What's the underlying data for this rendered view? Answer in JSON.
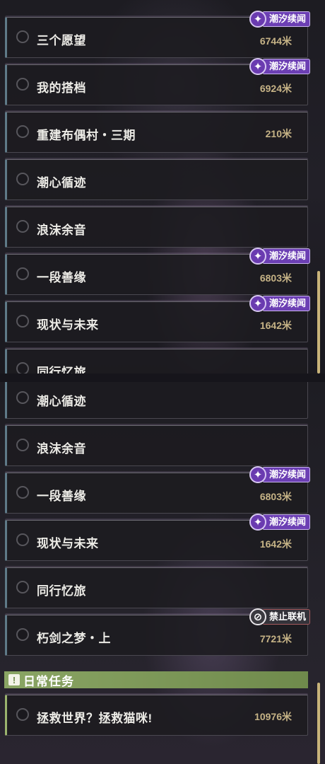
{
  "tags": {
    "tide": {
      "label": "潮汐续闻",
      "icon": "tide-wave-icon",
      "icon_glyph": "✦",
      "color": "#6c3fb4"
    },
    "nocoop": {
      "label": "禁止联机",
      "icon": "no-coop-icon",
      "icon_glyph": "⊘",
      "color": "#34333a"
    }
  },
  "top_list": [
    {
      "title": "三个愿望",
      "distance": "6744米",
      "tag": "tide"
    },
    {
      "title": "我的搭档",
      "distance": "6924米",
      "tag": "tide"
    },
    {
      "title": "重建布偶村・三期",
      "distance": "210米",
      "tag": null
    },
    {
      "title": "潮心循迹",
      "distance": "",
      "tag": null
    },
    {
      "title": "浪沫余音",
      "distance": "",
      "tag": null
    },
    {
      "title": "一段善缘",
      "distance": "6803米",
      "tag": "tide"
    },
    {
      "title": "现状与未来",
      "distance": "1642米",
      "tag": "tide"
    },
    {
      "title": "同行忆旅",
      "distance": "",
      "tag": null
    }
  ],
  "bottom_list": [
    {
      "title": "潮心循迹",
      "distance": "",
      "tag": null
    },
    {
      "title": "浪沫余音",
      "distance": "",
      "tag": null
    },
    {
      "title": "一段善缘",
      "distance": "6803米",
      "tag": "tide"
    },
    {
      "title": "现状与未来",
      "distance": "1642米",
      "tag": "tide"
    },
    {
      "title": "同行忆旅",
      "distance": "",
      "tag": null
    },
    {
      "title": "朽剑之梦・上",
      "distance": "7721米",
      "tag": "nocoop"
    }
  ],
  "daily_section": {
    "title": "日常任务",
    "icon": "exclamation-icon",
    "items": [
      {
        "title": "拯救世界？拯救猫咪!",
        "distance": "10976米",
        "tag": null
      }
    ]
  },
  "colors": {
    "accent_gold": "#c6b386",
    "daily_green": "#8aa564",
    "quest_bar": "#5f7a88"
  }
}
